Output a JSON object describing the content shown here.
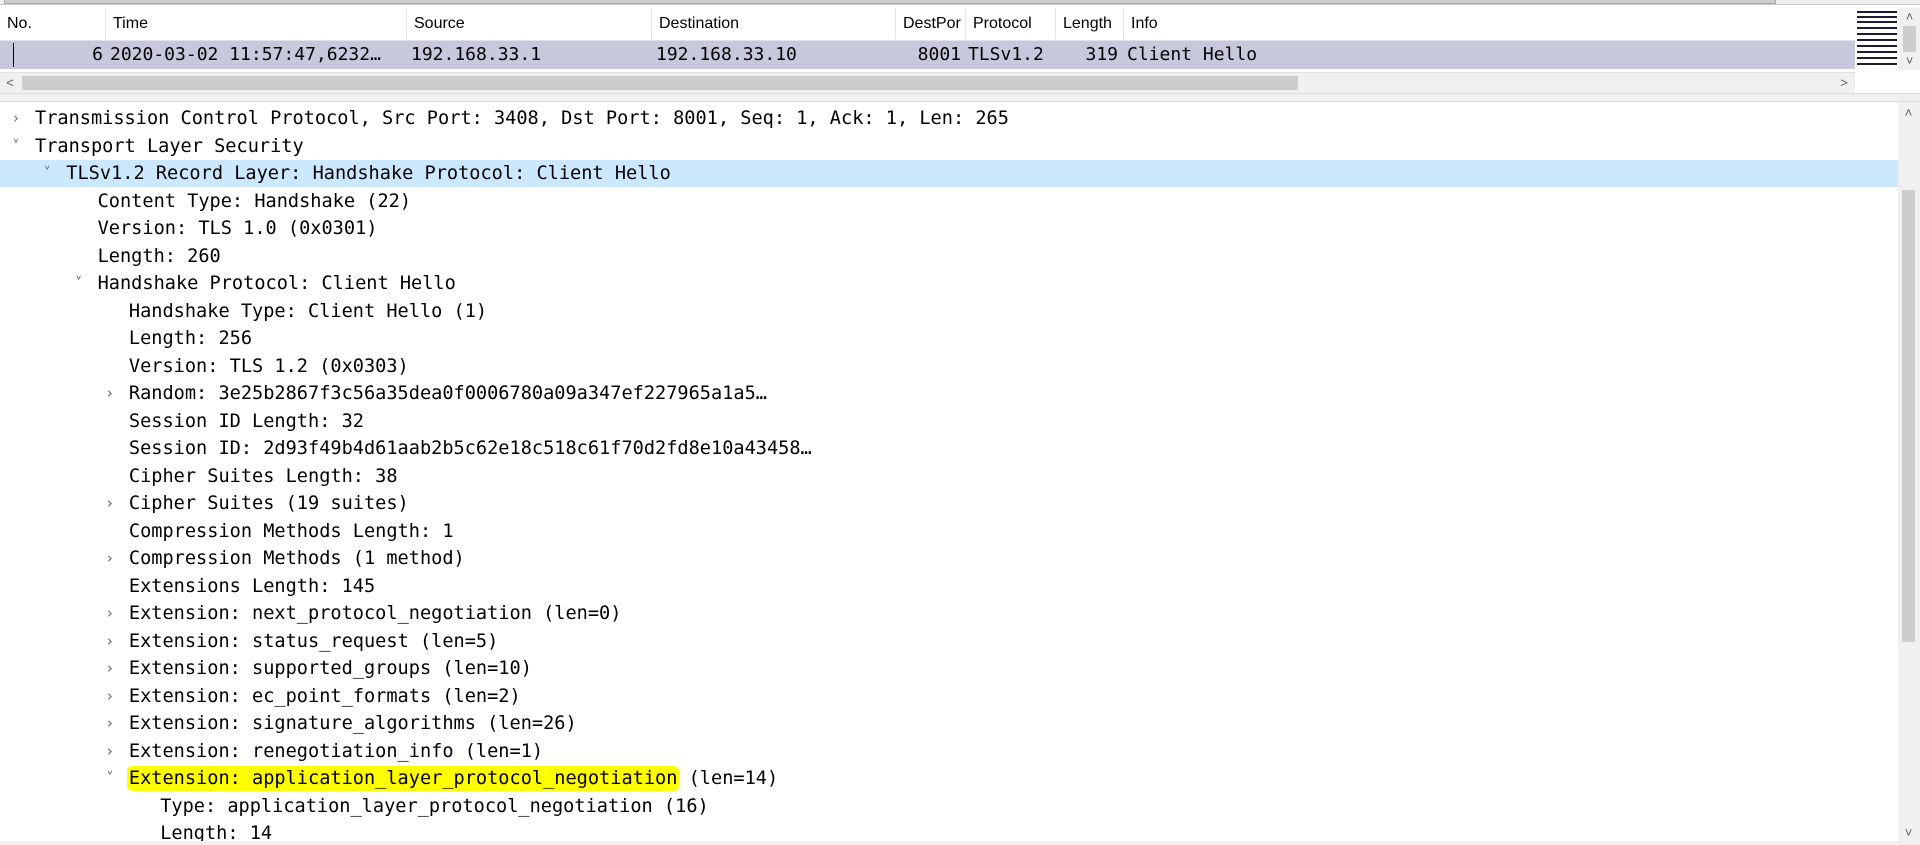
{
  "packet_list": {
    "columns": [
      "No.",
      "Time",
      "Source",
      "Destination",
      "DestPor",
      "Protocol",
      "Length",
      "Info"
    ],
    "row": {
      "no": "6",
      "time": "2020-03-02 11:57:47,6232…",
      "source": "192.168.33.1",
      "destination": "192.168.33.10",
      "dest_port": "8001",
      "protocol": "TLSv1.2",
      "length": "319",
      "info": "Client Hello"
    }
  },
  "scroll": {
    "left_arrow": "<",
    "right_arrow": ">",
    "up_arrow": "˄",
    "down_arrow": "˅"
  },
  "details": {
    "lines": [
      {
        "text": "Transmission Control Protocol, Src Port: 3408, Dst Port: 8001, Seq: 1, Ack: 1, Len: 265",
        "expander": ">"
      },
      {
        "text": "Transport Layer Security",
        "expander": "v"
      },
      {
        "text": "TLSv1.2 Record Layer: Handshake Protocol: Client Hello",
        "expander": "v"
      },
      {
        "text": "Content Type: Handshake (22)"
      },
      {
        "text": "Version: TLS 1.0 (0x0301)"
      },
      {
        "text": "Length: 260"
      },
      {
        "text": "Handshake Protocol: Client Hello",
        "expander": "v"
      },
      {
        "text": "Handshake Type: Client Hello (1)"
      },
      {
        "text": "Length: 256"
      },
      {
        "text": "Version: TLS 1.2 (0x0303)"
      },
      {
        "text": "Random: 3e25b2867f3c56a35dea0f0006780a09a347ef227965a1a5…",
        "expander": ">"
      },
      {
        "text": "Session ID Length: 32"
      },
      {
        "text": "Session ID: 2d93f49b4d61aab2b5c62e18c518c61f70d2fd8e10a43458…"
      },
      {
        "text": "Cipher Suites Length: 38"
      },
      {
        "text": "Cipher Suites (19 suites)",
        "expander": ">"
      },
      {
        "text": "Compression Methods Length: 1"
      },
      {
        "text": "Compression Methods (1 method)",
        "expander": ">"
      },
      {
        "text": "Extensions Length: 145"
      },
      {
        "text": "Extension: next_protocol_negotiation (len=0)",
        "expander": ">"
      },
      {
        "text": "Extension: status_request (len=5)",
        "expander": ">"
      },
      {
        "text": "Extension: supported_groups (len=10)",
        "expander": ">"
      },
      {
        "text": "Extension: ec_point_formats (len=2)",
        "expander": ">"
      },
      {
        "text": "Extension: signature_algorithms (len=26)",
        "expander": ">"
      },
      {
        "text": "Extension: renegotiation_info (len=1)",
        "expander": ">"
      },
      {
        "text": "Extension: application_layer_protocol_negotiation",
        "suffix": " (len=14)",
        "expander": "v"
      },
      {
        "text": "Type: application_layer_protocol_negotiation (16)"
      },
      {
        "text": "Length: 14"
      }
    ],
    "selected_line_index": 2,
    "highlighted_line_index": 24
  },
  "colors": {
    "selected_row": "#c8c8dc",
    "tree_selection": "#cce8ff",
    "marker_highlight": "#ffff00"
  },
  "icons": {
    "collapsed": "chevron-right-icon",
    "expanded": "chevron-down-icon"
  }
}
